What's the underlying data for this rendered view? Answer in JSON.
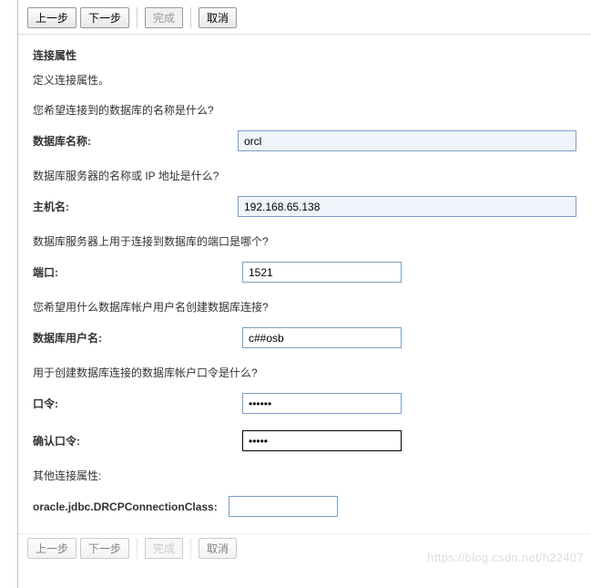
{
  "buttons": {
    "prev": "上一步",
    "next": "下一步",
    "finish": "完成",
    "cancel": "取消"
  },
  "header": {
    "title": "连接属性",
    "subtitle": "定义连接属性。"
  },
  "fields": {
    "dbname_q": "您希望连接到的数据库的名称是什么?",
    "dbname_label": "数据库名称:",
    "dbname_value": "orcl",
    "host_q": "数据库服务器的名称或 IP 地址是什么?",
    "host_label": "主机名:",
    "host_value": "192.168.65.138",
    "port_q": "数据库服务器上用于连接到数据库的端口是哪个?",
    "port_label": "端口:",
    "port_value": "1521",
    "user_q": "您希望用什么数据库帐户用户名创建数据库连接?",
    "user_label": "数据库用户名:",
    "user_value": "c##osb",
    "pwd_q": "用于创建数据库连接的数据库帐户口令是什么?",
    "pwd_label": "口令:",
    "pwd_value": "••••••",
    "pwd2_label": "确认口令:",
    "pwd2_value": "•••••",
    "other_title": "其他连接属性:",
    "drcp_label": "oracle.jdbc.DRCPConnectionClass:",
    "drcp_value": ""
  },
  "watermark": "https://blog.csdn.net/h22407"
}
